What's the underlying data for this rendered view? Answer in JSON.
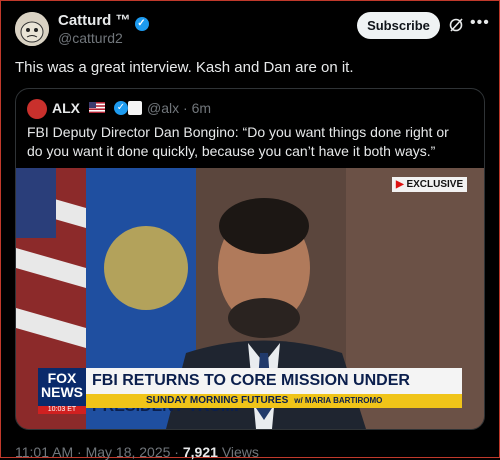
{
  "author": {
    "name": "Catturd ™",
    "handle": "@catturd2"
  },
  "subscribe_label": "Subscribe",
  "tweet_text": "This was a great interview. Kash and Dan are on it.",
  "quote": {
    "name": "ALX",
    "handle": "@alx",
    "time": "6m",
    "text": "FBI Deputy Director Dan Bongino: “Do you want things done right or do you want it done quickly, because you can’t have it both ways.”"
  },
  "video": {
    "badge": "EXCLUSIVE",
    "logo": "FOX NEWS",
    "clock": "10:03 ET",
    "headline": "FBI RETURNS TO CORE MISSION UNDER PRESIDENT TRUMP",
    "show": "SUNDAY MORNING FUTURES",
    "show_host": "w/ MARIA BARTIROMO"
  },
  "meta": {
    "time": "11:01 AM",
    "date": "May 18, 2025",
    "views_count": "7,921",
    "views_label": "Views"
  },
  "icons": [
    "verified-badge-icon",
    "grok-icon",
    "more-icon",
    "us-flag-icon"
  ],
  "colors": {
    "background": "#000000",
    "text": "#e7e9ea",
    "muted": "#71767b",
    "accent": "#1d9bf0"
  }
}
